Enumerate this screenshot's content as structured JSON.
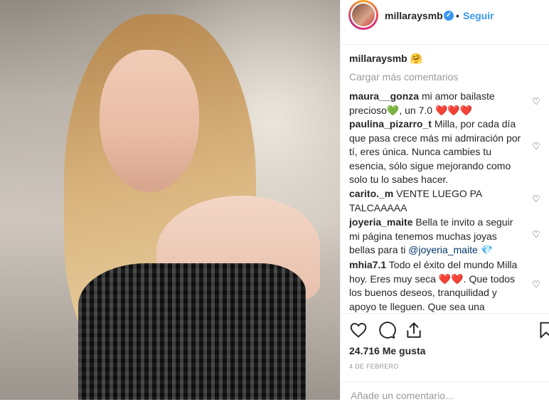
{
  "post": {
    "username": "millaraysmb",
    "follow_label": "Seguir",
    "dot": "•"
  },
  "caption": {
    "username": "millaraysmb",
    "emoji": "🤗"
  },
  "load_more_label": "Cargar más comentarios",
  "comments": [
    {
      "user": "maura__gonza",
      "text_a": "mi amor bailaste precioso",
      "emoji_green": "💚",
      "text_b": ", un 7.0 ",
      "hearts": "❤️❤️❤️"
    },
    {
      "user": "paulina_pizarro_t",
      "text": "Milla, por cada día que pasa crece más mi admiración por tí, eres única. Nunca cambies tu esencia, sólo sigue mejorando como solo tu lo sabes hacer."
    },
    {
      "user": "carito._m",
      "text": "VENTE LUEGO PA TALCAAAAA"
    },
    {
      "user": "joyeria_maite",
      "text_a": "Bella te invito a seguir mi página tenemos muchas joyas bellas para ti ",
      "mention": "@joyeria_maite",
      "gem": "💎"
    },
    {
      "user": "mhia7.1",
      "text_a": "Todo el éxito del mundo Milla hoy. Eres muy seca ",
      "hearts": "❤️❤️",
      "text_b": ". Que todos los buenos deseos, tranquilidad y apoyo te lleguen. Que sea una"
    }
  ],
  "likes": "24.716 Me gusta",
  "date": "4 DE FEBRERO",
  "add_comment_placeholder": "Añade un comentario...",
  "icons": [
    "heart-icon",
    "comment-icon",
    "share-icon",
    "bookmark-icon",
    "verified-icon"
  ],
  "colors": {
    "accent": "#3897f0",
    "like_red": "#ed4956",
    "muted": "#999999"
  }
}
